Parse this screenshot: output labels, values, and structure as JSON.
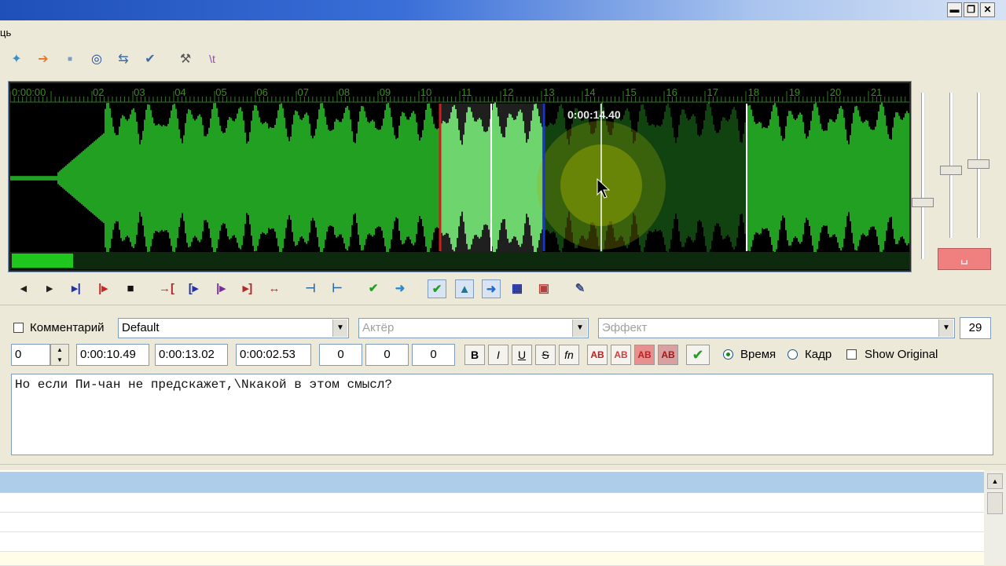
{
  "window": {
    "buttons": [
      "▬",
      "❐",
      "✕"
    ]
  },
  "menu": {
    "partial_item": "ць"
  },
  "toolbar": {
    "icons": [
      "pin-icon",
      "play-icon",
      "stop-small-icon",
      "target-icon",
      "shift-times-icon",
      "check-icon",
      "hammer-icon",
      "tag-icon"
    ]
  },
  "audio": {
    "ruler_start": "0:00:00",
    "ruler_ticks": [
      "02",
      "03",
      "04",
      "05",
      "06",
      "07",
      "08",
      "09",
      "10",
      "11",
      "12",
      "13",
      "14",
      "15",
      "16",
      "17",
      "18",
      "19",
      "20",
      "21"
    ],
    "cursor_time": "0:00:14.40",
    "karaoke_glyph": "␣"
  },
  "audio_controls": {
    "icons": [
      "◂",
      "▸",
      "▸|",
      "|▸",
      "■",
      "→[",
      "[▸",
      "|▸",
      "▸]",
      "↔",
      "⊣",
      "⊢",
      "✔",
      "➜",
      "✔",
      "▲",
      "➜",
      "▦",
      "▣",
      "✎"
    ]
  },
  "edit": {
    "comment_label": "Комментарий",
    "style": "Default",
    "actor_placeholder": "Актёр",
    "effect_placeholder": "Эффект",
    "char_count": "29",
    "layer": "0",
    "start_time": "0:00:10.49",
    "end_time": "0:00:13.02",
    "duration": "0:00:02.53",
    "margin_l": "0",
    "margin_r": "0",
    "margin_v": "0",
    "bold": "B",
    "italic": "I",
    "underline": "U",
    "strike": "S",
    "font": "fn",
    "color1": "AB",
    "color2": "AB",
    "color3": "AB",
    "color4": "AB",
    "time_label": "Время",
    "frame_label": "Кадр",
    "show_original_label": "Show Original",
    "text": "Но если Пи-чан не предскажет,\\Nкакой в этом смысл?"
  },
  "colors": {
    "wave_green": "#22a022",
    "selection_green": "#4ccf4c",
    "marker_red": "#cc2020",
    "marker_blue": "#1a38c8",
    "grid_header": "#aecde8"
  }
}
